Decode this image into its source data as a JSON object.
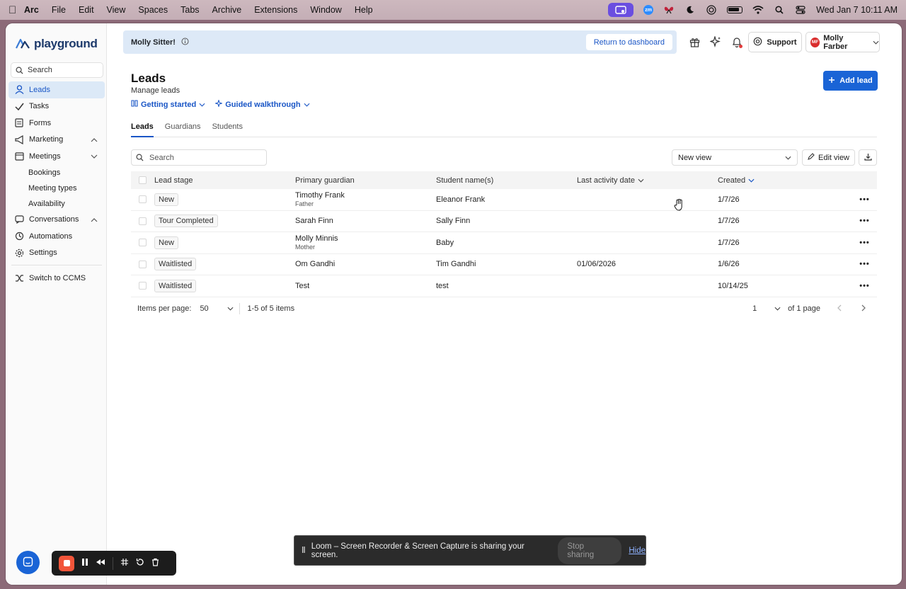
{
  "menubar": {
    "app": "Arc",
    "items": [
      "File",
      "Edit",
      "View",
      "Spaces",
      "Tabs",
      "Archive",
      "Extensions",
      "Window",
      "Help"
    ],
    "zoom_label": "zm",
    "datetime": "Wed Jan 7  10:11 AM"
  },
  "sidebar": {
    "brand": "playground",
    "search_placeholder": "Search",
    "items": [
      {
        "label": "Leads",
        "icon": "user-icon",
        "active": true
      },
      {
        "label": "Tasks",
        "icon": "check-icon"
      },
      {
        "label": "Forms",
        "icon": "form-icon"
      },
      {
        "label": "Marketing",
        "icon": "megaphone-icon",
        "expanded": true
      },
      {
        "label": "Meetings",
        "icon": "calendar-icon",
        "expanded": false
      },
      {
        "label": "Bookings",
        "sub": true
      },
      {
        "label": "Meeting types",
        "sub": true
      },
      {
        "label": "Availability",
        "sub": true
      },
      {
        "label": "Conversations",
        "icon": "chat-icon",
        "expanded": true
      },
      {
        "label": "Automations",
        "icon": "automation-icon"
      },
      {
        "label": "Settings",
        "icon": "gear-icon"
      },
      {
        "label": "Switch to CCMS",
        "icon": "switch-icon"
      }
    ]
  },
  "banner": {
    "title": "Molly Sitter!",
    "return_label": "Return to dashboard"
  },
  "header": {
    "support_label": "Support",
    "user_initials": "MF",
    "user_name": "Molly Farber"
  },
  "page": {
    "title": "Leads",
    "subtitle": "Manage leads",
    "links": [
      "Getting started",
      "Guided walkthrough"
    ],
    "add_label": "Add lead",
    "tabs": [
      "Leads",
      "Guardians",
      "Students"
    ]
  },
  "table": {
    "search_placeholder": "Search",
    "view_label": "New view",
    "edit_view_label": "Edit view",
    "columns": [
      "Lead stage",
      "Primary guardian",
      "Student name(s)",
      "Last activity date",
      "Created"
    ],
    "rows": [
      {
        "stage": "New",
        "guardian": "Timothy Frank",
        "relation": "Father",
        "student": "Eleanor Frank",
        "activity": "",
        "created": "1/7/26"
      },
      {
        "stage": "Tour Completed",
        "guardian": "Sarah Finn",
        "relation": "",
        "student": "Sally Finn",
        "activity": "",
        "created": "1/7/26"
      },
      {
        "stage": "New",
        "guardian": "Molly Minnis",
        "relation": "Mother",
        "student": "Baby",
        "activity": "",
        "created": "1/7/26"
      },
      {
        "stage": "Waitlisted",
        "guardian": "Om Gandhi",
        "relation": "",
        "student": "Tim Gandhi",
        "activity": "01/06/2026",
        "created": "1/6/26"
      },
      {
        "stage": "Waitlisted",
        "guardian": "Test",
        "relation": "",
        "student": "test",
        "activity": "",
        "created": "10/14/25"
      }
    ],
    "more_label": "•••"
  },
  "pager": {
    "items_per_page_label": "Items per page:",
    "items_per_page": "50",
    "range": "1-5 of 5 items",
    "page": "1",
    "of_pages": "of 1 page"
  },
  "loom": {
    "message": "Loom – Screen Recorder & Screen Capture is sharing your screen.",
    "stop_label": "Stop sharing",
    "hide_label": "Hide"
  }
}
